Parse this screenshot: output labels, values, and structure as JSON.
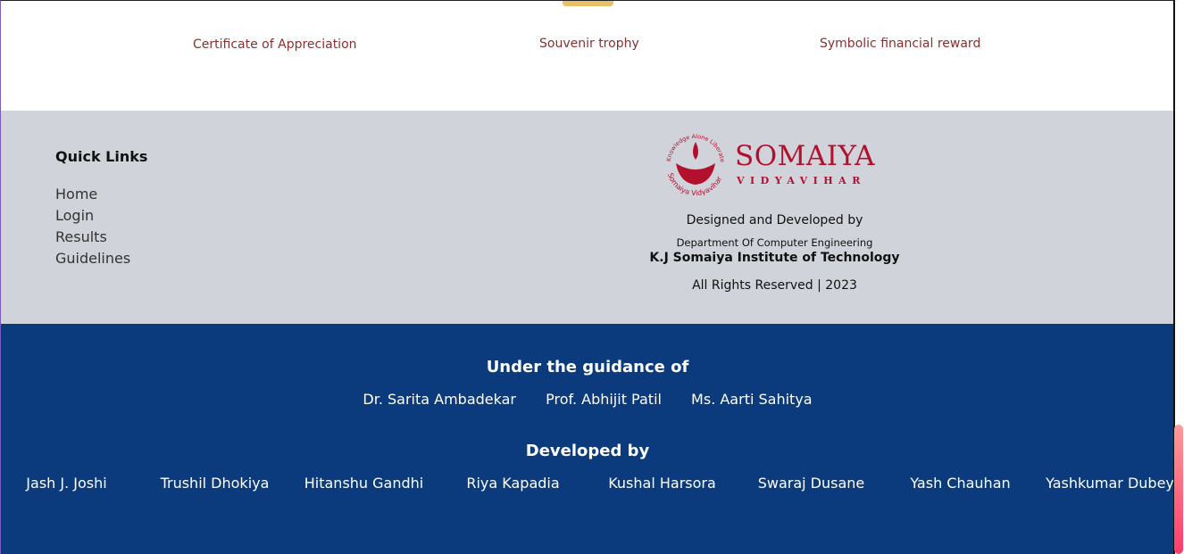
{
  "rewards": {
    "items": [
      "Certificate of Appreciation",
      "Souvenir trophy",
      "Symbolic financial reward"
    ]
  },
  "quick_links": {
    "title": "Quick Links",
    "items": [
      "Home",
      "Login",
      "Results",
      "Guidelines"
    ]
  },
  "brand": {
    "name": "SOMAIYA",
    "sub": "VIDYAVIHAR",
    "logo_ring_text_top": "Knowledge Alone Liberates",
    "logo_ring_text_bottom": "Somaiya Vidyavihar",
    "color": "#b3102e"
  },
  "credits": {
    "designed": "Designed and Developed by",
    "dept": "Department Of Computer Engineering",
    "institute": "K.J Somaiya Institute of Technology",
    "rights": "All Rights Reserved | 2023"
  },
  "guidance": {
    "title": "Under the guidance of",
    "names": [
      "Dr. Sarita Ambadekar",
      "Prof. Abhijit Patil",
      "Ms. Aarti Sahitya"
    ]
  },
  "developers": {
    "title": "Developed by",
    "names": [
      "Jash J. Joshi",
      "Trushil Dhokiya",
      "Hitanshu Gandhi",
      "Riya Kapadia",
      "Kushal Harsora",
      "Swaraj Dusane",
      "Yash Chauhan",
      "Yashkumar Dubey"
    ]
  },
  "colors": {
    "footer_gray": "#d1d3da",
    "footer_blue": "#0b3b7c",
    "reward_text": "#8b2e2e"
  }
}
